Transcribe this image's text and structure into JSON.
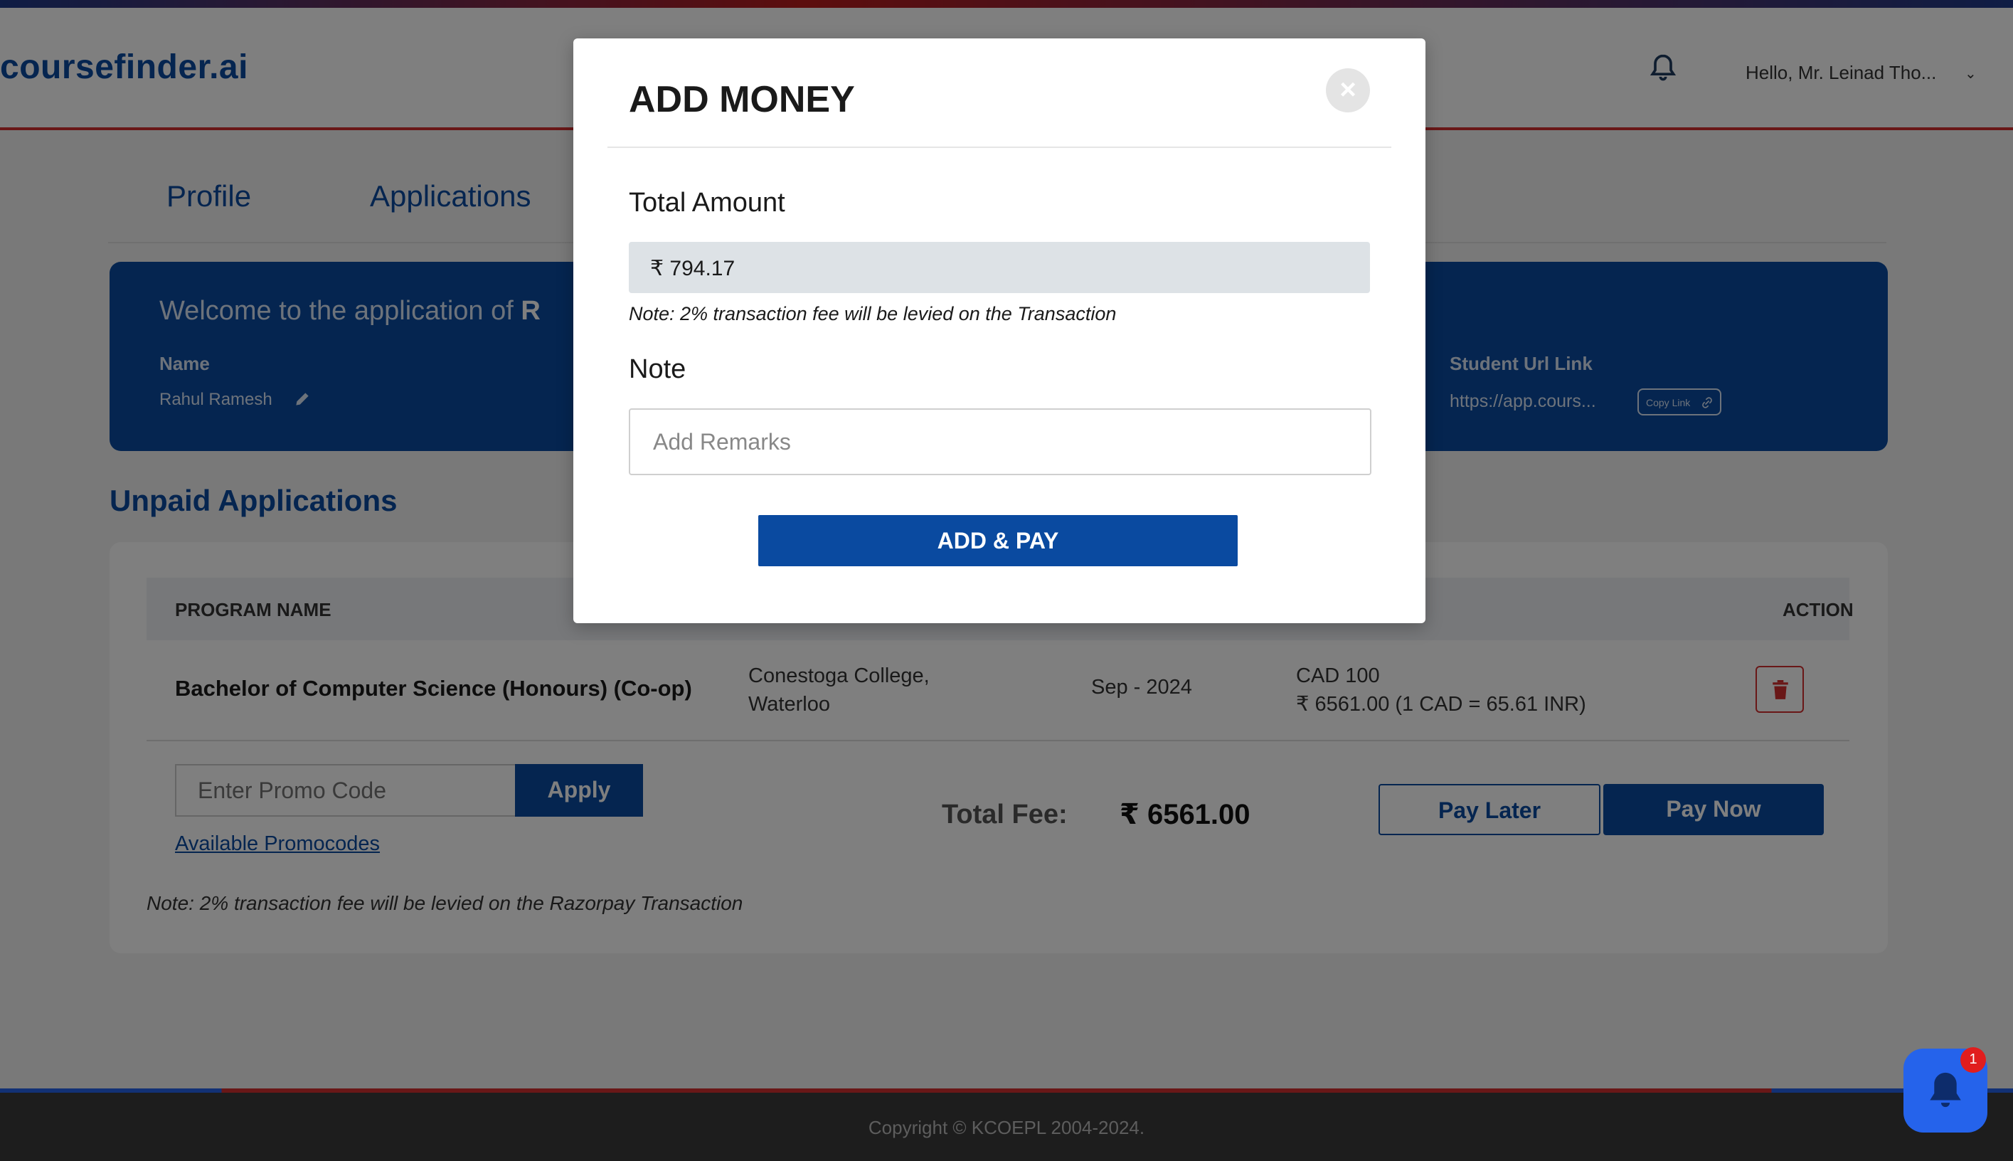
{
  "header": {
    "logo": "coursefinder.ai",
    "greeting": "Hello,  Mr. Leinad Tho...",
    "notification_icon": "bell-icon"
  },
  "tabs": [
    {
      "label": "Profile"
    },
    {
      "label": "Applications"
    }
  ],
  "banner": {
    "welcome_prefix": "Welcome to the application of ",
    "welcome_name_visible": "R",
    "name_label": "Name",
    "name_value": "Rahul Ramesh",
    "student_url_label": "Student Url Link",
    "student_url_value": "https://app.cours...",
    "copy_link_label": "Copy Link"
  },
  "unpaid": {
    "title": "Unpaid Applications",
    "columns": {
      "program": "PROGRAM NAME",
      "action": "ACTION"
    },
    "rows": [
      {
        "program": "Bachelor of Computer Science (Honours) (Co-op)",
        "institution_line1": "Conestoga College,",
        "institution_line2": "Waterloo",
        "intake": "Sep - 2024",
        "fee_line1": "CAD 100",
        "fee_line2": "₹ 6561.00 (1 CAD = 65.61 INR)"
      }
    ],
    "promo_placeholder": "Enter Promo Code",
    "apply_label": "Apply",
    "available_promocodes": "Available Promocodes",
    "total_fee_label": "Total Fee:",
    "total_fee_value": "₹ 6561.00",
    "pay_later_label": "Pay Later",
    "pay_now_label": "Pay Now",
    "note": "Note: 2% transaction fee will be levied on the Razorpay Transaction"
  },
  "footer": {
    "copyright": "Copyright © KCOEPL 2004-2024."
  },
  "floating_bell": {
    "badge": "1"
  },
  "modal": {
    "title": "ADD MONEY",
    "close_symbol": "×",
    "total_amount_label": "Total Amount",
    "total_amount_value": "₹ 794.17",
    "fee_note": "Note: 2% transaction fee will be levied on the Transaction",
    "note_label": "Note",
    "note_placeholder": "Add Remarks",
    "note_value": "",
    "submit_label": "ADD & PAY"
  },
  "colors": {
    "brand_blue": "#0a4aa0",
    "accent_red": "#d32f2f",
    "badge_red": "#e11d1d"
  }
}
